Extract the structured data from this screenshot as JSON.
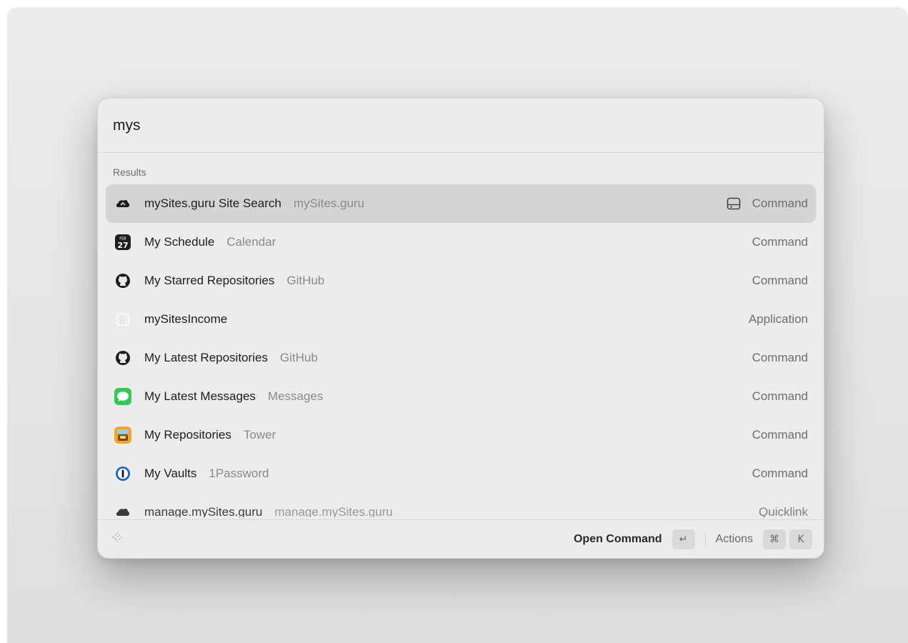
{
  "search": {
    "value": "mys",
    "placeholder": ""
  },
  "section_label": "Results",
  "results": [
    {
      "title": "mySites.guru Site Search",
      "subtitle": "mySites.guru",
      "kind": "Command",
      "icon": "cloud-icon",
      "selected": true
    },
    {
      "title": "My Schedule",
      "subtitle": "Calendar",
      "kind": "Command",
      "icon": "calendar-icon",
      "cal_month": "FEB",
      "cal_day": "27"
    },
    {
      "title": "My Starred Repositories",
      "subtitle": "GitHub",
      "kind": "Command",
      "icon": "github-icon"
    },
    {
      "title": "mySitesIncome",
      "subtitle": "",
      "kind": "Application",
      "icon": "app-grid-icon"
    },
    {
      "title": "My Latest Repositories",
      "subtitle": "GitHub",
      "kind": "Command",
      "icon": "github-icon"
    },
    {
      "title": "My Latest Messages",
      "subtitle": "Messages",
      "kind": "Command",
      "icon": "messages-icon"
    },
    {
      "title": "My Repositories",
      "subtitle": "Tower",
      "kind": "Command",
      "icon": "tower-icon"
    },
    {
      "title": "My Vaults",
      "subtitle": "1Password",
      "kind": "Command",
      "icon": "1password-icon"
    },
    {
      "title": "manage.mySites.guru",
      "subtitle": "manage.mySites.guru",
      "kind": "Quicklink",
      "icon": "cloud-icon"
    }
  ],
  "footer": {
    "primary_action": "Open Command",
    "enter_key": "↵",
    "actions_label": "Actions",
    "cmd_key": "⌘",
    "k_key": "K"
  },
  "colors": {
    "selected_row": "#d4d4d4",
    "panel_bg": "#ececec",
    "messages_green": "#34c759",
    "onepassword_blue": "#1a66c9"
  }
}
